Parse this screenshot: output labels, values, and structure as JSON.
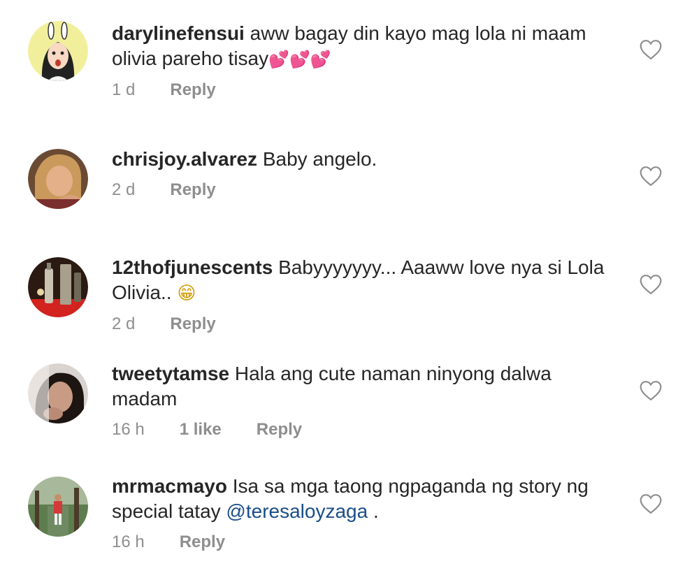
{
  "comments": [
    {
      "username": "darylinefensui",
      "text": "aww bagay din kayo mag lola ni maam olivia pareho tisay",
      "emoji": "💕💕💕",
      "time": "1 d",
      "likes": "",
      "reply": "Reply"
    },
    {
      "username": "chrisjoy.alvarez",
      "text": "Baby angelo.",
      "time": "2 d",
      "likes": "",
      "reply": "Reply"
    },
    {
      "username": "12thofjunescents",
      "text": "Babyyyyyyy... Aaaww love nya si Lola Olivia..",
      "emoji": "😁",
      "time": "2 d",
      "likes": "",
      "reply": "Reply"
    },
    {
      "username": "tweetytamse",
      "text": "Hala ang cute naman ninyong dalwa madam",
      "time": "16 h",
      "likes": "1 like",
      "reply": "Reply"
    },
    {
      "username": "mrmacmayo",
      "text": "Isa sa mga taong ngpaganda ng story ng special tatay",
      "mention": "@teresaloyzaga",
      "suffix": " .",
      "time": "16 h",
      "likes": "",
      "reply": "Reply"
    }
  ],
  "colors": {
    "text": "#262626",
    "meta": "#8e8e8e",
    "mention": "#1a4e8a",
    "heart_outline": "#8e8e8e"
  },
  "icons": {
    "like": "heart-outline-icon"
  }
}
